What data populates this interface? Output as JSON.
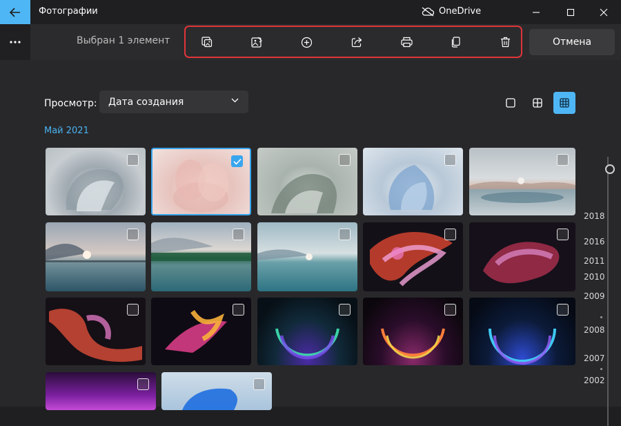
{
  "app": {
    "title": "Фотографии",
    "onedrive_label": "OneDrive"
  },
  "commandbar": {
    "selection_text": "Выбран 1 элемент",
    "cancel_label": "Отмена",
    "tools": [
      "edit-image-icon",
      "edit-create-icon",
      "add-to-icon",
      "share-icon",
      "print-icon",
      "copy-icon",
      "delete-icon"
    ]
  },
  "view": {
    "label": "Просмотр:",
    "selected_option": "Дата создания"
  },
  "gallery": {
    "month": "Май 2021",
    "selected_count": 1,
    "photos": [
      {
        "name": "Windows 11 bloom gray 1",
        "selected": false
      },
      {
        "name": "Windows 11 bloom pink",
        "selected": true
      },
      {
        "name": "Windows 11 bloom gray 2",
        "selected": false
      },
      {
        "name": "Windows 11 bloom blue",
        "selected": false
      },
      {
        "name": "Lake landscape 1",
        "selected": false
      },
      {
        "name": "Lake landscape 2",
        "selected": false
      },
      {
        "name": "Lake landscape 3",
        "selected": false
      },
      {
        "name": "Lake landscape 4",
        "selected": false
      },
      {
        "name": "Abstract flow 1",
        "selected": false
      },
      {
        "name": "Abstract flow 2",
        "selected": false
      },
      {
        "name": "Abstract flow 3",
        "selected": false
      },
      {
        "name": "Abstract flow 4",
        "selected": false
      },
      {
        "name": "Glow arc 1",
        "selected": false
      },
      {
        "name": "Glow arc 2",
        "selected": false
      },
      {
        "name": "Glow arc 3",
        "selected": false
      },
      {
        "name": "Dark gradient",
        "selected": false
      },
      {
        "name": "Windows 11 bloom blue 2",
        "selected": false
      }
    ]
  },
  "timeline": {
    "years": [
      "2018",
      "2016",
      "2011",
      "2010",
      "2009",
      "2008",
      "2007",
      "2002"
    ]
  },
  "colors": {
    "accent": "#4fb6f5",
    "highlight_border": "#e0353a",
    "background": "#28282a"
  }
}
